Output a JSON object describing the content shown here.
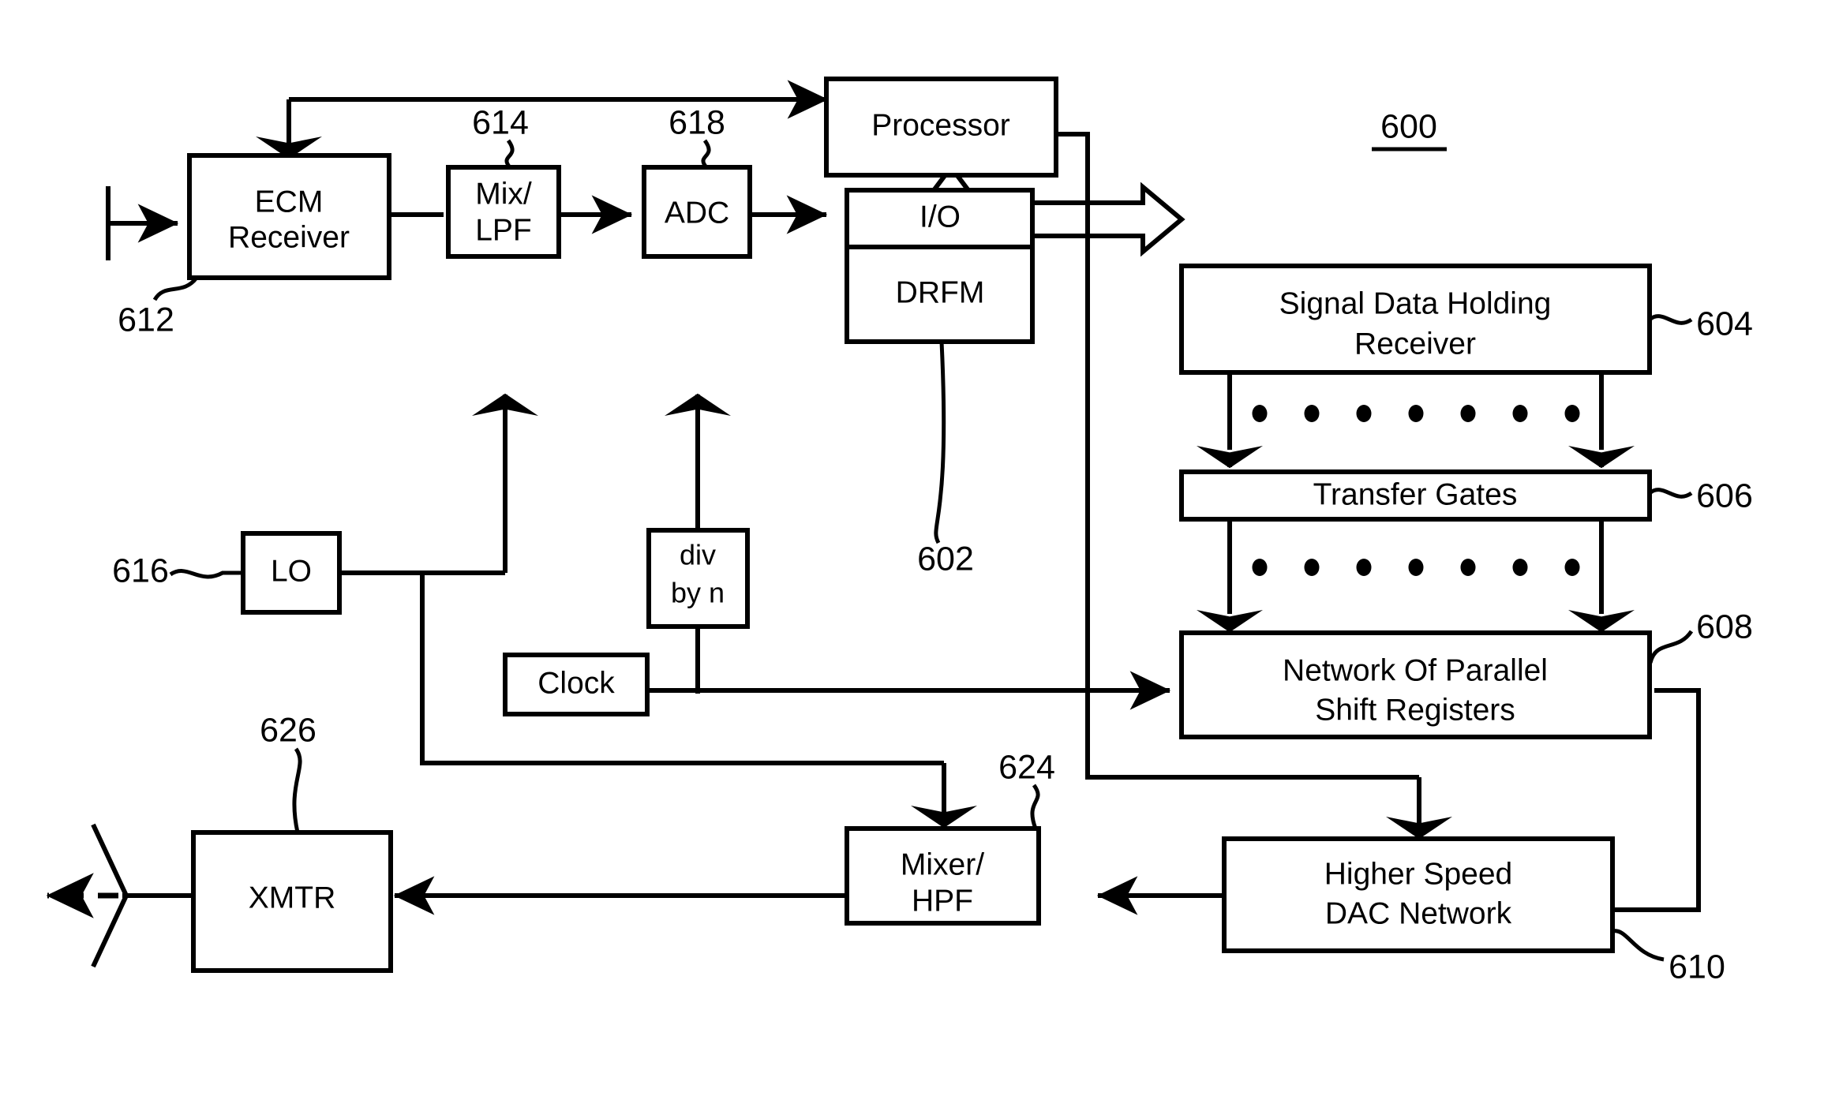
{
  "figure": {
    "number": "600",
    "number_underlined": true
  },
  "blocks": {
    "ecm_receiver": {
      "line1": "ECM",
      "line2": "Receiver"
    },
    "mix_lpf": {
      "line1": "Mix/",
      "line2": "LPF"
    },
    "adc": {
      "line1": "ADC"
    },
    "io": {
      "line1": "I/O"
    },
    "drfm": {
      "line1": "DRFM"
    },
    "processor": {
      "line1": "Processor"
    },
    "lo": {
      "line1": "LO"
    },
    "div_by_n": {
      "line1": "div",
      "line2": "by n"
    },
    "clock": {
      "line1": "Clock"
    },
    "signal_data_holding_receiver": {
      "line1": "Signal Data Holding",
      "line2": "Receiver"
    },
    "transfer_gates": {
      "line1": "Transfer Gates"
    },
    "shift_registers": {
      "line1": "Network Of Parallel",
      "line2": "Shift Registers"
    },
    "dac_network": {
      "line1": "Higher Speed",
      "line2": "DAC Network"
    },
    "mixer_hpf": {
      "line1": "Mixer/",
      "line2": "HPF"
    },
    "xmtr": {
      "line1": "XMTR"
    }
  },
  "reference_numerals": {
    "drfm_unit": "602",
    "signal_data_holding_receiver": "604",
    "transfer_gates": "606",
    "shift_registers": "608",
    "dac_network": "610",
    "ecm_receiver": "612",
    "mix_lpf": "614",
    "lo": "616",
    "adc": "618",
    "mixer_hpf": "624",
    "xmtr": "626"
  },
  "ellipsis": {
    "dot_count": 7
  },
  "colors": {
    "stroke": "#000000",
    "fill": "#ffffff"
  }
}
